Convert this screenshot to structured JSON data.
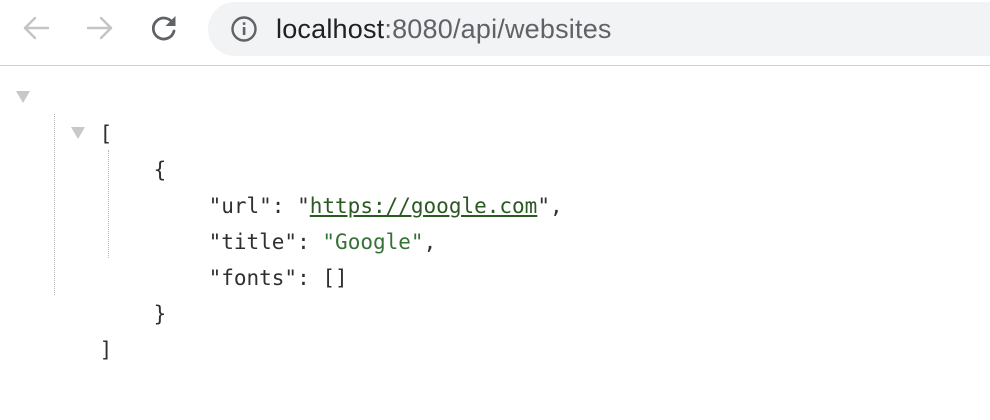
{
  "browser": {
    "url_host": "localhost",
    "url_rest": ":8080/api/websites",
    "icons": {
      "back": "arrow-left-icon",
      "forward": "arrow-right-icon",
      "reload": "reload-icon",
      "site_info": "info-icon"
    }
  },
  "json": {
    "open_bracket": "[",
    "close_bracket": "]",
    "open_brace": "{",
    "close_brace": "}",
    "fields": [
      {
        "key": "\"url\"",
        "value": "https://google.com",
        "value_is_link": true
      },
      {
        "key": "\"title\"",
        "value": "Google",
        "value_is_link": false
      },
      {
        "key": "\"fonts\"",
        "value": "[]",
        "value_is_link": false
      }
    ]
  },
  "colors": {
    "string": "#347235",
    "link": "#2a5a22",
    "toolbar_bg": "#f1f3f4"
  }
}
